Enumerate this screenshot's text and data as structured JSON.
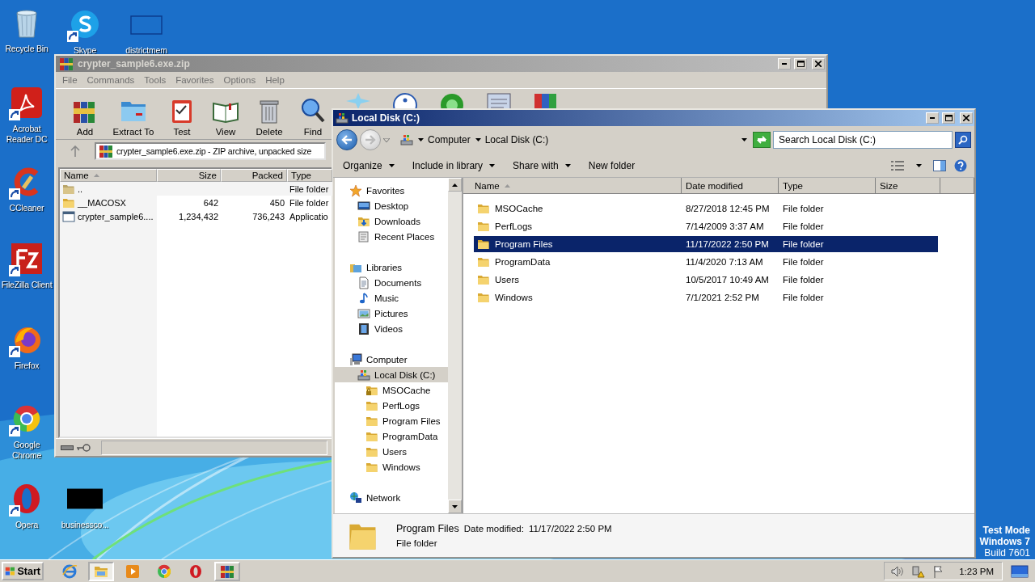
{
  "desktop": {
    "icons": [
      {
        "kind": "recycle",
        "label": "Recycle Bin",
        "shortcut": false
      },
      {
        "kind": "skype",
        "label": "Skype",
        "shortcut": true
      },
      {
        "kind": "blank",
        "label": "districtmem",
        "shortcut": false
      },
      {
        "kind": "acrobat",
        "label": "Acrobat Reader DC",
        "shortcut": true
      },
      {
        "kind": "ccleaner",
        "label": "CCleaner",
        "shortcut": true
      },
      {
        "kind": "filezilla",
        "label": "FileZilla Client",
        "shortcut": true
      },
      {
        "kind": "firefox",
        "label": "Firefox",
        "shortcut": true
      },
      {
        "kind": "chrome",
        "label": "Google Chrome",
        "shortcut": true
      },
      {
        "kind": "opera",
        "label": "Opera",
        "shortcut": true
      },
      {
        "kind": "redacted",
        "label": "businessco...",
        "shortcut": false
      }
    ],
    "edition": [
      "Test Mode",
      "Windows 7",
      "Build 7601"
    ]
  },
  "winrar": {
    "title": "crypter_sample6.exe.zip",
    "menu": [
      "File",
      "Commands",
      "Tools",
      "Favorites",
      "Options",
      "Help"
    ],
    "tools": [
      {
        "kind": "add",
        "label": "Add"
      },
      {
        "kind": "extract",
        "label": "Extract To"
      },
      {
        "kind": "test",
        "label": "Test"
      },
      {
        "kind": "view",
        "label": "View"
      },
      {
        "kind": "delete",
        "label": "Delete"
      },
      {
        "kind": "find",
        "label": "Find"
      },
      {
        "kind": "wizard"
      },
      {
        "kind": "info"
      },
      {
        "kind": "scan"
      },
      {
        "kind": "comment"
      },
      {
        "kind": "sfx"
      }
    ],
    "path": "crypter_sample6.exe.zip - ZIP archive, unpacked size",
    "columns": [
      "Name",
      "Size",
      "Packed",
      "Type"
    ],
    "rows": [
      {
        "kind": "up",
        "name": "..",
        "type": "File folder"
      },
      {
        "kind": "folder",
        "name": "__MACOSX",
        "size": "642",
        "packed": "450",
        "type": "File folder"
      },
      {
        "kind": "file",
        "name": "crypter_sample6....",
        "size": "1,234,432",
        "packed": "736,243",
        "type": "Applicatio"
      }
    ]
  },
  "explorer": {
    "title": "Local Disk (C:)",
    "breadcrumb": [
      "Computer",
      "Local Disk (C:)"
    ],
    "search": {
      "placeholder": "Search Local Disk (C:)"
    },
    "commands": [
      {
        "label": "Organize",
        "menu": true
      },
      {
        "label": "Include in library",
        "menu": true
      },
      {
        "label": "Share with",
        "menu": true
      },
      {
        "label": "New folder",
        "menu": false
      }
    ],
    "nav": [
      {
        "kind": "star",
        "label": "Favorites",
        "selected": false,
        "children": [
          {
            "kind": "desktop",
            "label": "Desktop",
            "selected": false
          },
          {
            "kind": "downloads",
            "label": "Downloads",
            "selected": false
          },
          {
            "kind": "recent",
            "label": "Recent Places",
            "selected": false
          }
        ]
      },
      {
        "kind": "libraries",
        "label": "Libraries",
        "selected": false,
        "children": [
          {
            "kind": "documents",
            "label": "Documents",
            "selected": false
          },
          {
            "kind": "music",
            "label": "Music",
            "selected": false
          },
          {
            "kind": "pictures",
            "label": "Pictures",
            "selected": false
          },
          {
            "kind": "videos",
            "label": "Videos",
            "selected": false
          }
        ]
      },
      {
        "kind": "computer",
        "label": "Computer",
        "selected": false,
        "children": [
          {
            "kind": "disk",
            "label": "Local Disk (C:)",
            "selected": true,
            "children": [
              {
                "kind": "lockfolder",
                "label": "MSOCache",
                "selected": false
              },
              {
                "kind": "folder",
                "label": "PerfLogs",
                "selected": false
              },
              {
                "kind": "folder",
                "label": "Program Files",
                "selected": false
              },
              {
                "kind": "folder",
                "label": "ProgramData",
                "selected": false
              },
              {
                "kind": "folder",
                "label": "Users",
                "selected": false
              },
              {
                "kind": "folder",
                "label": "Windows",
                "selected": false
              }
            ]
          }
        ]
      },
      {
        "kind": "network",
        "label": "Network",
        "selected": false
      }
    ],
    "columns": [
      "Name",
      "Date modified",
      "Type",
      "Size"
    ],
    "rows": [
      {
        "name": "MSOCache",
        "date": "8/27/2018 12:45 PM",
        "type": "File folder",
        "selected": false
      },
      {
        "name": "PerfLogs",
        "date": "7/14/2009 3:37 AM",
        "type": "File folder",
        "selected": false
      },
      {
        "name": "Program Files",
        "date": "11/17/2022 2:50 PM",
        "type": "File folder",
        "selected": true
      },
      {
        "name": "ProgramData",
        "date": "11/4/2020 7:13 AM",
        "type": "File folder",
        "selected": false
      },
      {
        "name": "Users",
        "date": "10/5/2017 10:49 AM",
        "type": "File folder",
        "selected": false
      },
      {
        "name": "Windows",
        "date": "7/1/2021 2:52 PM",
        "type": "File folder",
        "selected": false
      }
    ],
    "details": {
      "name": "Program Files",
      "date_label": "Date modified:",
      "date": "11/17/2022 2:50 PM",
      "type": "File folder"
    }
  },
  "taskbar": {
    "start": "Start",
    "apps": [
      {
        "kind": "ie",
        "open": false,
        "selected": false
      },
      {
        "kind": "explorer",
        "open": true,
        "selected": true
      },
      {
        "kind": "media",
        "open": false,
        "selected": false
      },
      {
        "kind": "chrome",
        "open": false,
        "selected": false
      },
      {
        "kind": "opera",
        "open": false,
        "selected": false
      },
      {
        "kind": "winrar",
        "open": true,
        "selected": false
      }
    ],
    "time": "1:23 PM"
  }
}
